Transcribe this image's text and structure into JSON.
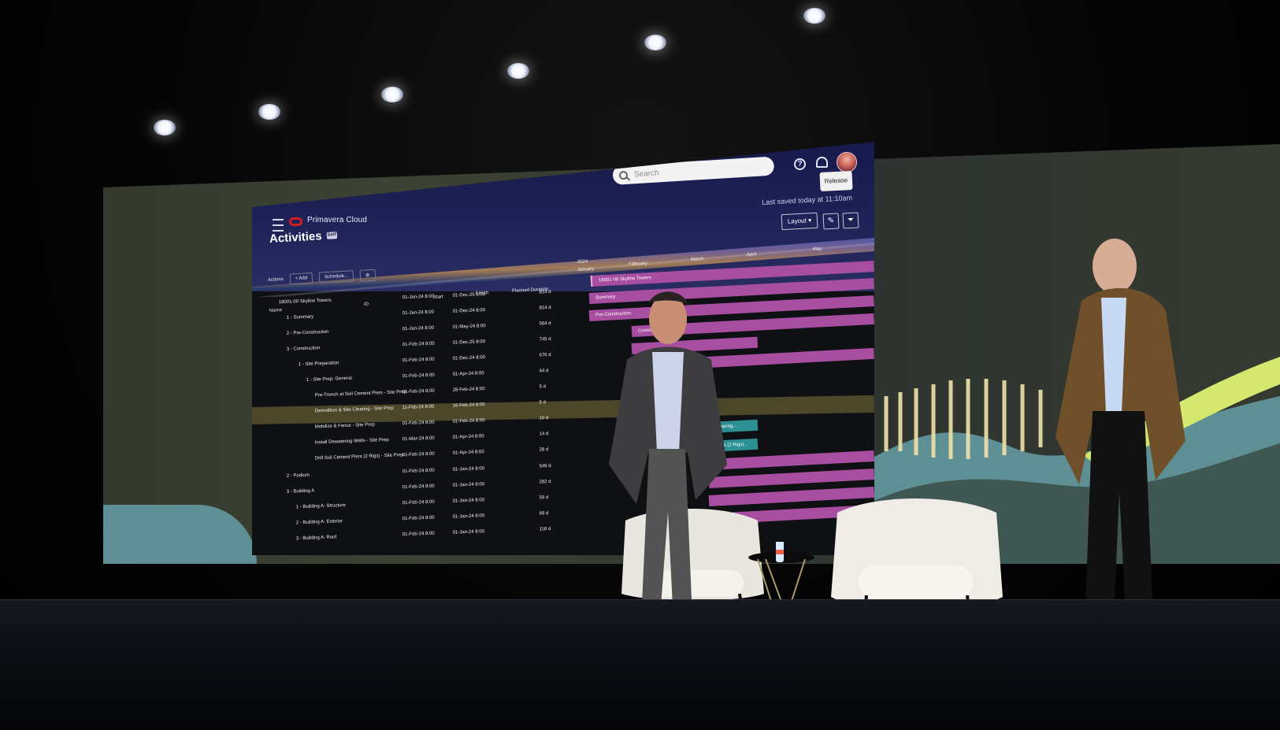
{
  "app": {
    "brand": "Primavera Cloud",
    "page_title": "Activities",
    "page_badge": "Self",
    "search_placeholder": "Search",
    "release_label": "Release",
    "saved_text": "Last saved today at 11:10am",
    "help_icon": "help-icon",
    "notifications_icon": "bell-icon"
  },
  "toolbar": {
    "actions": "Actions",
    "add": "+ Add",
    "schedule": "Schedule...",
    "layout": "Layout"
  },
  "table": {
    "columns": {
      "name": "Name",
      "id": "ID",
      "start": "Start",
      "finish": "Finish",
      "planned_duration": "Planned Duration"
    },
    "rows": [
      {
        "name": "18001-00 Skyline Towers",
        "start": "01-Jan-24 8:00",
        "finish": "01-Dec-25 8:00",
        "duration": "814 d"
      },
      {
        "name": "1 - Summary",
        "start": "01-Jan-24 8:00",
        "finish": "01-Dec-24 8:00",
        "duration": "814 d"
      },
      {
        "name": "2 - Pre-Construction",
        "start": "01-Jan-24 8:00",
        "finish": "01-May-24 8:00",
        "duration": "564 d"
      },
      {
        "name": "3 - Construction",
        "start": "01-Feb-24 8:00",
        "finish": "01-Dec-25 8:00",
        "duration": "745 d"
      },
      {
        "name": "1 - Site Preparation",
        "start": "01-Feb-24 8:00",
        "finish": "01-Dec-24 8:00",
        "duration": "676 d"
      },
      {
        "name": "1 - Site Prep: General",
        "start": "01-Feb-24 8:00",
        "finish": "01-Apr-24 8:00",
        "duration": "44 d"
      },
      {
        "name": "Pre-Trench at Soil Cement Piers - Site Prep",
        "start": "01-Feb-24 8:00",
        "finish": "28-Feb-24 8:00",
        "duration": "5 d"
      },
      {
        "name": "Demolition & Site Clearing - Site Prep",
        "start": "11-Feb-24 8:00",
        "finish": "16-Feb-24 8:00",
        "duration": "5 d"
      },
      {
        "name": "Mobilize & Fence - Site Prep",
        "start": "01-Feb-24 8:00",
        "finish": "01-Feb-24 8:00",
        "duration": "10 d"
      },
      {
        "name": "Install Dewatering Wells - Site Prep",
        "start": "01-Mar-24 8:00",
        "finish": "01-Apr-24 8:00",
        "duration": "14 d"
      },
      {
        "name": "Drill Soil Cement Piers (2 Rigs) - Site Prep",
        "start": "01-Feb-24 8:00",
        "finish": "01-Apr-24 8:00",
        "duration": "28 d"
      },
      {
        "name": "2 - Podium",
        "start": "01-Feb-24 8:00",
        "finish": "01-Jan-24 8:00",
        "duration": "549 d"
      },
      {
        "name": "3 - Building A",
        "start": "01-Feb-24 8:00",
        "finish": "01-Jan-24 8:00",
        "duration": "282 d"
      },
      {
        "name": "1 - Building A: Structure",
        "start": "01-Feb-24 8:00",
        "finish": "01-Jan-24 8:00",
        "duration": "59 d"
      },
      {
        "name": "2 - Building A: Exterior",
        "start": "01-Feb-24 8:00",
        "finish": "01-Jan-24 8:00",
        "duration": "68 d"
      },
      {
        "name": "3 - Building A: Roof",
        "start": "01-Feb-24 8:00",
        "finish": "01-Jan-24 8:00",
        "duration": "118 d"
      }
    ]
  },
  "gantt": {
    "year": "2024",
    "months": [
      "January",
      "February",
      "March",
      "April",
      "May"
    ],
    "bars": [
      {
        "label": "18001-00 Skyline Towers"
      },
      {
        "label": "Summary"
      },
      {
        "label": "Pre-Construction"
      },
      {
        "label": "Constr..."
      },
      {
        "label": ""
      },
      {
        "label": ""
      },
      {
        "label": "Clearing..."
      },
      {
        "label": "Piers (2 Rigs)..."
      }
    ]
  },
  "colors": {
    "header_navy": "#1e2358",
    "gantt_magenta": "#a84ea1",
    "highlight_row": "#514b2b",
    "oracle_red": "#d01d21"
  }
}
